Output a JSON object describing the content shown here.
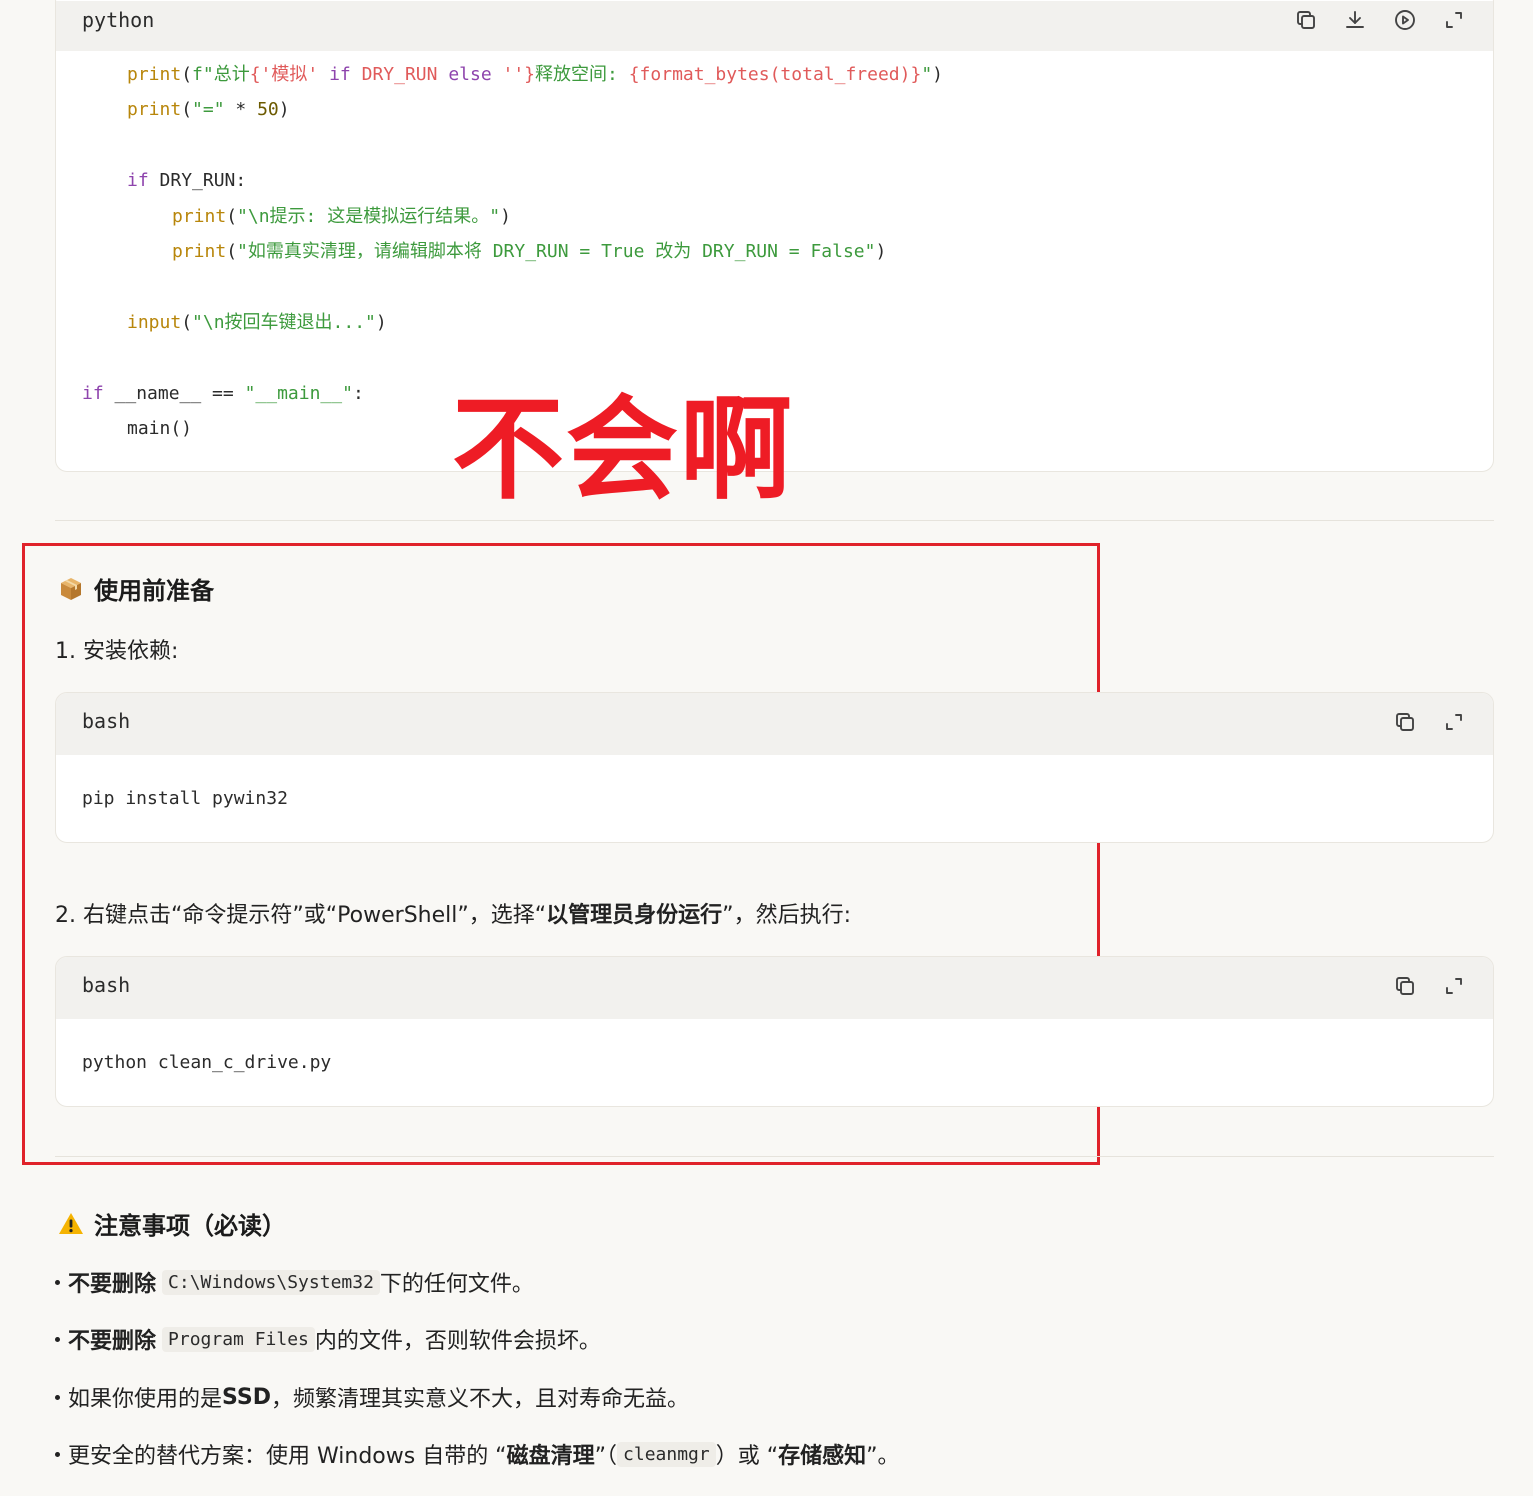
{
  "code_block_python": {
    "language": "python",
    "lines": [
      {
        "indent": 1,
        "segments": [
          [
            "f",
            "print"
          ],
          [
            "",
            "("
          ],
          [
            "s",
            "f\""
          ],
          [
            "s",
            "总计"
          ],
          [
            "it",
            "{'模拟' "
          ],
          [
            "k",
            "if"
          ],
          [
            "it",
            " DRY_RUN "
          ],
          [
            "k",
            "else"
          ],
          [
            "it",
            " ''}"
          ],
          [
            "s",
            "释放空间: "
          ],
          [
            "it",
            "{format_bytes(total_freed)}"
          ],
          [
            "s",
            "\""
          ],
          [
            "",
            ")"
          ]
        ]
      },
      {
        "indent": 1,
        "segments": [
          [
            "f",
            "print"
          ],
          [
            "",
            "("
          ],
          [
            "s",
            "\"=\""
          ],
          [
            "",
            " * "
          ],
          [
            "n",
            "50"
          ],
          [
            "",
            ")"
          ]
        ]
      },
      {
        "indent": 0,
        "segments": []
      },
      {
        "indent": 1,
        "segments": [
          [
            "k",
            "if"
          ],
          [
            "",
            " DRY_RUN:"
          ]
        ]
      },
      {
        "indent": 2,
        "segments": [
          [
            "f",
            "print"
          ],
          [
            "",
            "("
          ],
          [
            "s",
            "\"\\n提示: 这是模拟运行结果。\""
          ],
          [
            "",
            ")"
          ]
        ]
      },
      {
        "indent": 2,
        "segments": [
          [
            "f",
            "print"
          ],
          [
            "",
            "("
          ],
          [
            "s",
            "\"如需真实清理，请编辑脚本将 DRY_RUN = True 改为 DRY_RUN = False\""
          ],
          [
            "",
            ")"
          ]
        ]
      },
      {
        "indent": 0,
        "segments": []
      },
      {
        "indent": 1,
        "segments": [
          [
            "f",
            "input"
          ],
          [
            "",
            "("
          ],
          [
            "s",
            "\"\\n按回车键退出...\""
          ],
          [
            "",
            ")"
          ]
        ]
      },
      {
        "indent": 0,
        "segments": []
      },
      {
        "indent": 0,
        "segments": [
          [
            "k",
            "if"
          ],
          [
            "",
            " __name__ == "
          ],
          [
            "s",
            "\"__main__\""
          ],
          [
            "",
            ":"
          ]
        ]
      },
      {
        "indent": 1,
        "segments": [
          [
            "",
            "main()"
          ]
        ]
      }
    ]
  },
  "overlay_text": "不会啊",
  "section_prep": {
    "heading": "使用前准备",
    "step1": "1. 安装依赖:",
    "code1": {
      "language": "bash",
      "command": "pip install pywin32"
    },
    "step2_parts": {
      "a": "2. 右键点击“命令提示符”或“PowerShell”，选择“",
      "b": "以管理员身份运行",
      "c": "”，然后执行:"
    },
    "code2": {
      "language": "bash",
      "command": "python clean_c_drive.py"
    }
  },
  "section_notes": {
    "heading": "注意事项（必读）",
    "items": [
      {
        "bold": "不要删除",
        "code": "C:\\Windows\\System32",
        "text": "下的任何文件。"
      },
      {
        "bold": "不要删除",
        "code": "Program Files",
        "text": "内的文件，否则软件会损坏。"
      }
    ],
    "item3": {
      "pre": "如果你使用的是 ",
      "bold": "SSD",
      "post": "，频繁清理其实意义不大，且对寿命无益。"
    },
    "item4": {
      "pre": "更安全的替代方案：使用 Windows 自带的 “",
      "bold1": "磁盘清理",
      "mid1": "”（",
      "code": "cleanmgr",
      "mid2": "）或 “",
      "bold2": "存储感知",
      "post": "”。"
    }
  }
}
